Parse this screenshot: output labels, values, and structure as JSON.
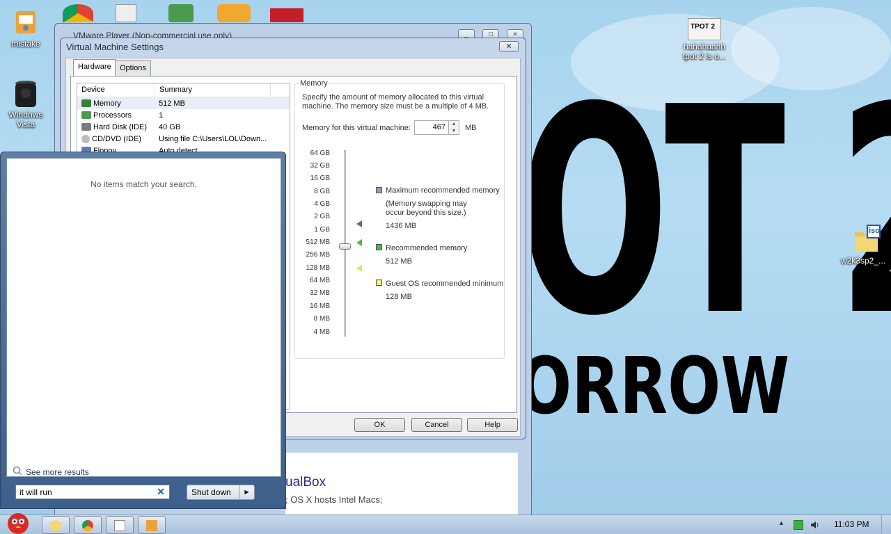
{
  "desktop": {
    "icons": [
      {
        "label": "mistake"
      },
      {
        "label": "Windows Vista"
      },
      {
        "label": "hahahaahh tpot 2 is o..."
      },
      {
        "label": "w2k3sp2_..."
      }
    ],
    "wallpaper": {
      "big_text": "OT 2",
      "sub_text": "ORROW"
    },
    "file_icon_text": "iso",
    "tpot_icon_text": "TPOT 2"
  },
  "vmware_window": {
    "title": "VMware Player (Non-commercial use only)",
    "content_heading": "ualBox",
    "content_text": "; OS X hosts Intel Macs;"
  },
  "settings_dialog": {
    "title": "Virtual Machine Settings",
    "tabs": [
      "Hardware",
      "Options"
    ],
    "device_list": {
      "headers": [
        "Device",
        "Summary"
      ],
      "rows": [
        {
          "device": "Memory",
          "summary": "512 MB"
        },
        {
          "device": "Processors",
          "summary": "1"
        },
        {
          "device": "Hard Disk (IDE)",
          "summary": "40 GB"
        },
        {
          "device": "CD/DVD (IDE)",
          "summary": "Using file C:\\Users\\LOL\\Down..."
        },
        {
          "device": "Floppy",
          "summary": "Auto detect"
        }
      ]
    },
    "memory": {
      "group_label": "Memory",
      "description": "Specify the amount of memory allocated to this virtual machine. The memory size must be a multiple of 4 MB.",
      "input_label": "Memory for this virtual machine:",
      "value": "467",
      "unit": "MB",
      "scale": [
        "64 GB",
        "32 GB",
        "16 GB",
        "8 GB",
        "4 GB",
        "2 GB",
        "1 GB",
        "512 MB",
        "256 MB",
        "128 MB",
        "64 MB",
        "32 MB",
        "16 MB",
        "8 MB",
        "4 MB"
      ],
      "recommendations": [
        {
          "label": "Maximum recommended memory",
          "note": "(Memory swapping may occur beyond this size.)",
          "value": "1436 MB",
          "color": "#8aa2b8"
        },
        {
          "label": "Recommended memory",
          "note": "",
          "value": "512 MB",
          "color": "#49b84a"
        },
        {
          "label": "Guest OS recommended minimum",
          "note": "",
          "value": "128 MB",
          "color": "#f5f07a"
        }
      ]
    },
    "buttons": {
      "ok": "OK",
      "cancel": "Cancel",
      "help": "Help"
    }
  },
  "start_menu": {
    "empty_message": "No items match your search.",
    "see_more": "See more results",
    "search_value": "it will run",
    "shutdown_label": "Shut down"
  },
  "taskbar": {
    "time": "11:03 PM"
  }
}
